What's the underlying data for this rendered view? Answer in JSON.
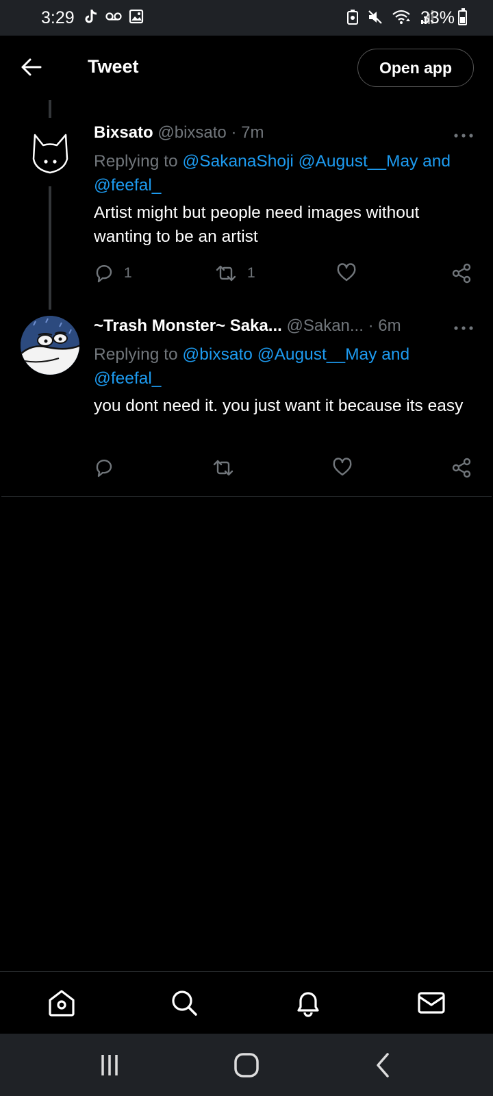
{
  "status_bar": {
    "time": "3:29",
    "battery": "33%",
    "left_icons": [
      "tiktok-icon",
      "voicemail-icon",
      "image-icon"
    ],
    "right_icons": [
      "data-saver-icon",
      "mute-icon",
      "wifi-icon",
      "signal-icon",
      "battery-icon"
    ]
  },
  "header": {
    "title": "Tweet",
    "open_app_label": "Open app"
  },
  "tweets": [
    {
      "name": "Bixsato",
      "handle": "@bixsato",
      "dot": "·",
      "time": "7m",
      "replying_prefix": "Replying to ",
      "mention_1": "@SakanaShoji",
      "mention_2": "@August__May",
      "and": "and",
      "mention_3": "@feefal_",
      "text": "Artist might but people need images without wanting to be an artist",
      "reply_count": "1",
      "retweet_count": "1",
      "like_count": "",
      "avatar": "cat-face-avatar"
    },
    {
      "name": "~Trash Monster~ Saka...",
      "handle": "@Sakan...",
      "dot": "·",
      "time": "6m",
      "replying_prefix": "Replying to ",
      "mention_1": "@bixsato",
      "mention_2": "@August__May",
      "and": "and",
      "mention_3": "@feefal_",
      "text": "you dont need it. you just want it because its easy",
      "reply_count": "",
      "retweet_count": "",
      "like_count": "",
      "avatar": "creature-avatar"
    }
  ],
  "bottom_nav": [
    "home-icon",
    "search-icon",
    "notifications-icon",
    "messages-icon"
  ],
  "system_nav": [
    "recents-icon",
    "home-button-icon",
    "back-icon"
  ],
  "colors": {
    "background": "#000000",
    "link": "#1d9bf0",
    "muted": "#71767b",
    "bar": "#1f2226"
  }
}
